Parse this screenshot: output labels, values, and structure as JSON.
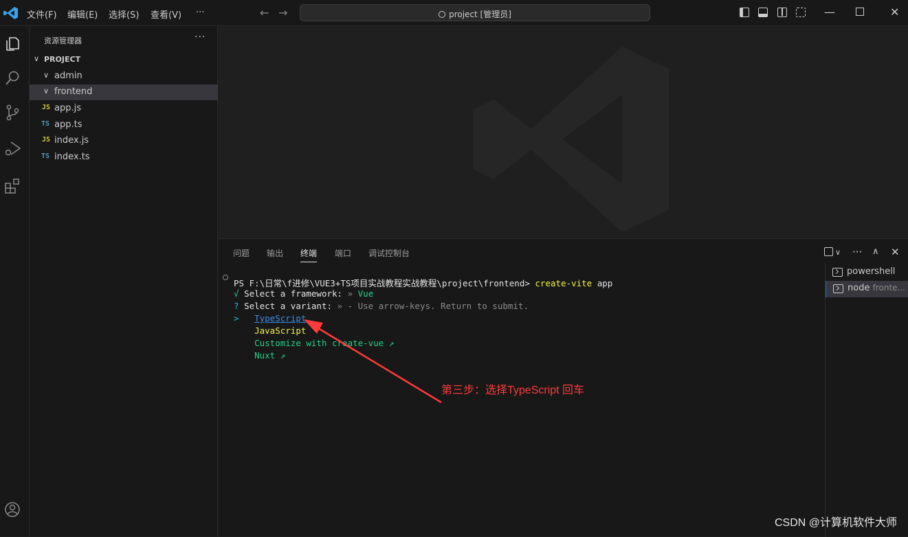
{
  "titlebar": {
    "menus": [
      "文件(F)",
      "编辑(E)",
      "选择(S)",
      "查看(V)",
      "···"
    ],
    "search_text": "project [管理员]",
    "back_icon": "arrow-left-icon",
    "forward_icon": "arrow-right-icon"
  },
  "activity_bar": {
    "icons": [
      "explorer-icon",
      "search-icon",
      "source-control-icon",
      "run-debug-icon",
      "extensions-icon",
      "accounts-icon"
    ]
  },
  "sidebar": {
    "title": "资源管理器",
    "more": "···",
    "project_label": "PROJECT",
    "folders": [
      {
        "label": "admin"
      },
      {
        "label": "frontend"
      }
    ],
    "files": [
      {
        "badge": "JS",
        "label": "app.js"
      },
      {
        "badge": "TS",
        "label": "app.ts"
      },
      {
        "badge": "JS",
        "label": "index.js"
      },
      {
        "badge": "TS",
        "label": "index.ts"
      }
    ]
  },
  "panel": {
    "tabs": [
      "问题",
      "输出",
      "终端",
      "端口",
      "调试控制台"
    ],
    "active_tab": "终端",
    "actions_more": "···"
  },
  "terminal": {
    "prompt": "PS F:\\日常\\f进修\\VUE3+TS项目实战教程实战教程\\project\\frontend>",
    "command": "create-vite",
    "command_arg": "app",
    "line2_check": "√",
    "line2_text": "Select a framework:",
    "line2_sep": "»",
    "line2_value": "Vue",
    "line3_q": "?",
    "line3_text": "Select a variant:",
    "line3_hint": "» - Use arrow-keys. Return to submit.",
    "cursor": ">",
    "options": [
      "TypeScript",
      "JavaScript",
      "Customize with create-vue ↗",
      "Nuxt ↗"
    ]
  },
  "annotation": {
    "text": "第三步：选择TypeScript 回车",
    "color": "#ff3b3b"
  },
  "terminal_list": [
    {
      "name": "powershell",
      "sub": ""
    },
    {
      "name": "node",
      "sub": "fronte..."
    }
  ],
  "credit": "CSDN @计算机软件大师",
  "colors": {
    "accent": "#0078d4",
    "js_badge": "#cbcb41",
    "ts_badge": "#519aba"
  }
}
